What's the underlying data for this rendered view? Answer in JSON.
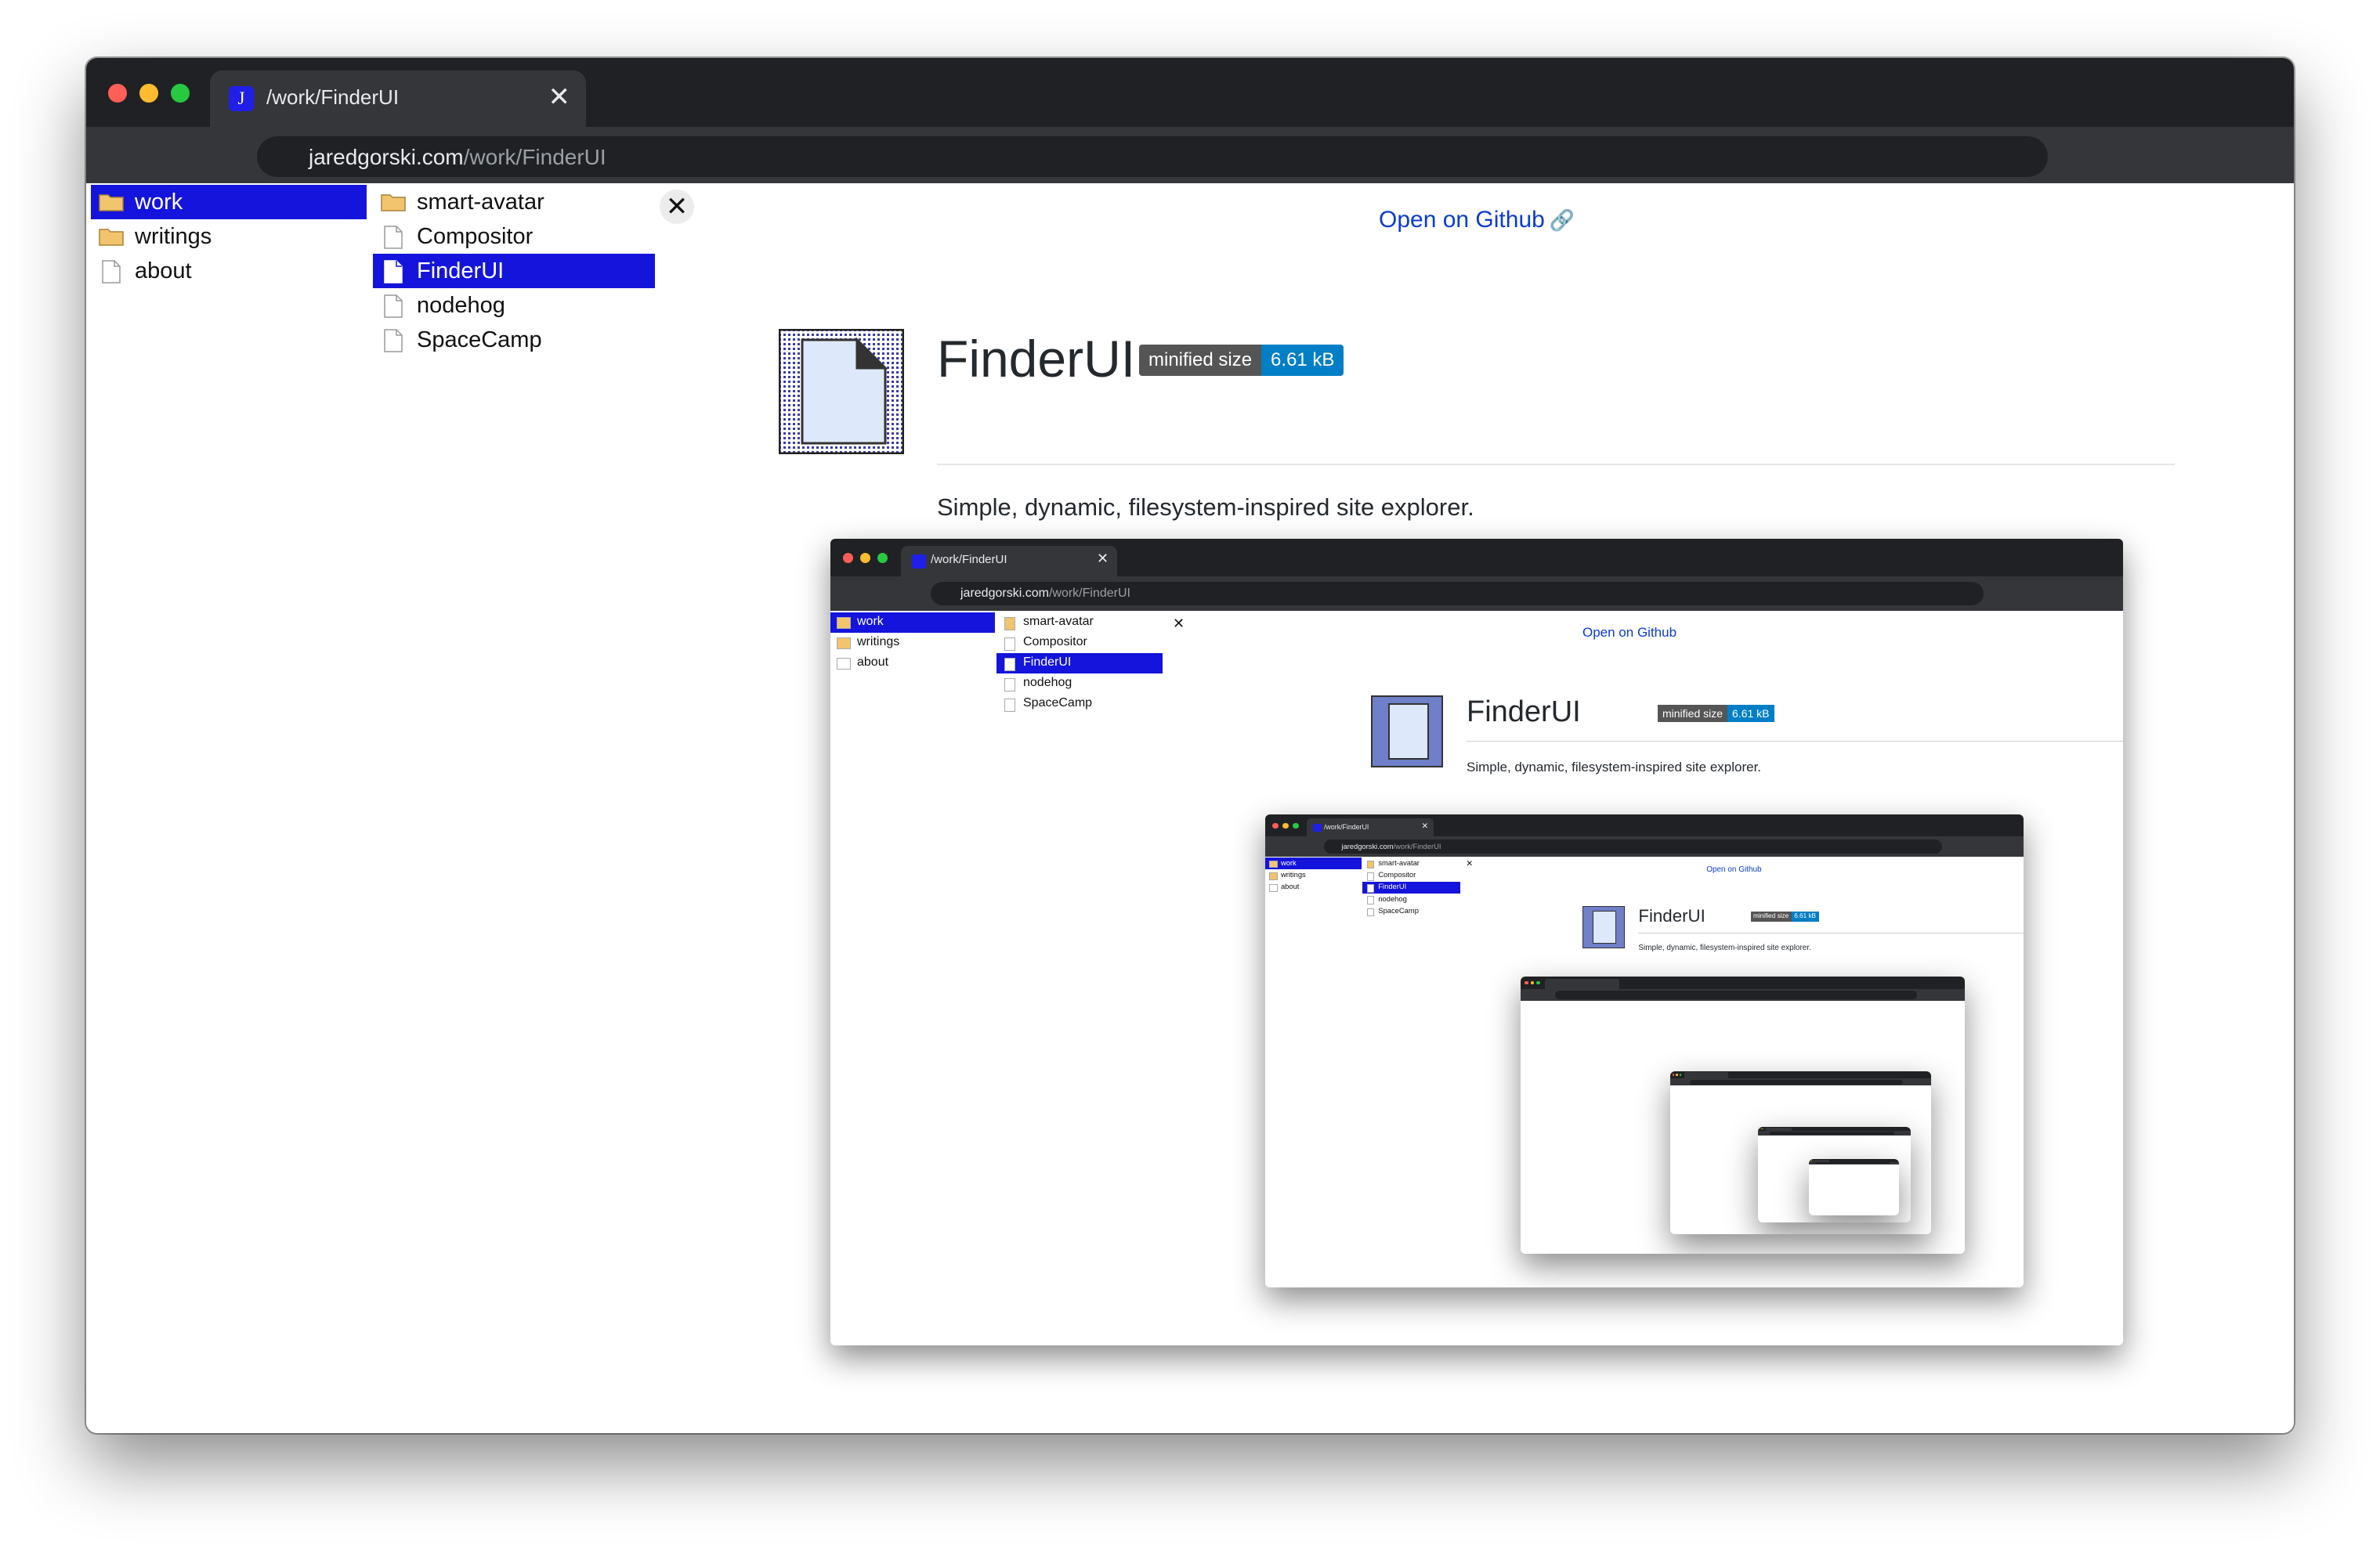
{
  "browser": {
    "tab_title": "/work/FinderUI",
    "favicon_letter": "J",
    "tab_close": "✕",
    "url_domain": "jaredgorski.com",
    "url_path": "/work/FinderUI",
    "traffic_lights": [
      "#ff5f57",
      "#febc2e",
      "#28c840"
    ]
  },
  "finder": {
    "column1": [
      {
        "label": "work",
        "icon": "folder-icon",
        "selected": true
      },
      {
        "label": "writings",
        "icon": "folder-icon",
        "selected": false
      },
      {
        "label": "about",
        "icon": "file-icon",
        "selected": false
      }
    ],
    "column2": [
      {
        "label": "smart-avatar",
        "icon": "folder-icon",
        "selected": false
      },
      {
        "label": "Compositor",
        "icon": "file-icon",
        "selected": false
      },
      {
        "label": "FinderUI",
        "icon": "file-icon",
        "selected": true
      },
      {
        "label": "nodehog",
        "icon": "file-icon",
        "selected": false
      },
      {
        "label": "SpaceCamp",
        "icon": "file-icon",
        "selected": false
      }
    ],
    "close_glyph": "✕",
    "selection_color": "#1414dc"
  },
  "project": {
    "github_link": "Open on Github",
    "link_icon": "🔗",
    "title": "FinderUI",
    "badge_label": "minified size",
    "badge_value": "6.61 kB",
    "badge_colors": [
      "#555555",
      "#007ec6"
    ],
    "description": "Simple, dynamic, filesystem-inspired site explorer.",
    "app_icon": "document-icon"
  }
}
